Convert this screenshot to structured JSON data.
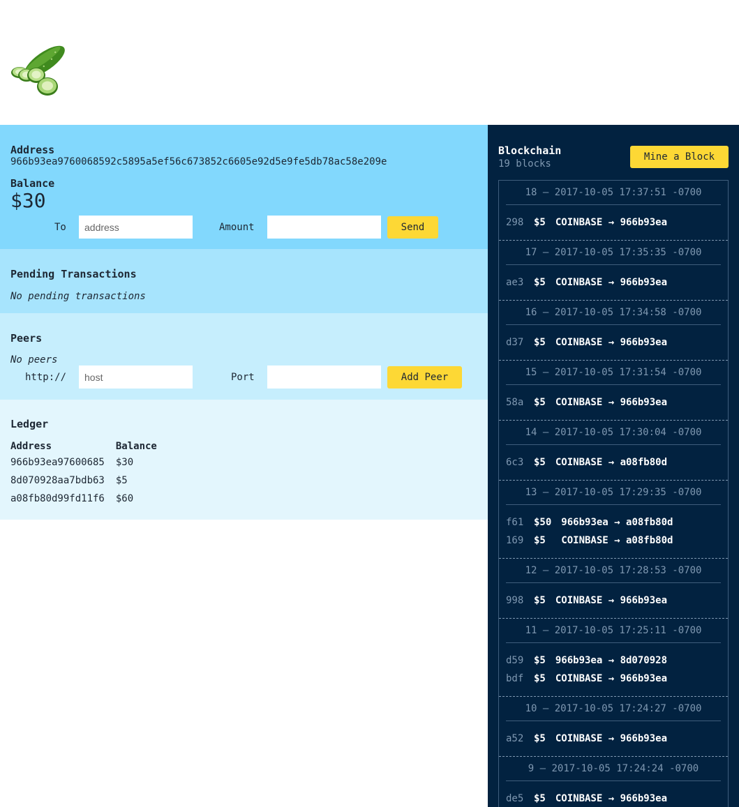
{
  "logo": {
    "icon": "cucumber-icon"
  },
  "wallet": {
    "address_label": "Address",
    "address": "966b93ea9760068592c5895a5ef56c673852c6605e92d5e9fe5db78ac58e209e",
    "balance_label": "Balance",
    "balance": "$30",
    "to_label": "To",
    "to_placeholder": "address",
    "amount_label": "Amount",
    "amount_value": "",
    "send_label": "Send"
  },
  "pending": {
    "title": "Pending Transactions",
    "empty_text": "No pending transactions"
  },
  "peers": {
    "title": "Peers",
    "empty_text": "No peers",
    "protocol_label": "http://",
    "host_placeholder": "host",
    "port_label": "Port",
    "port_value": "",
    "add_label": "Add Peer"
  },
  "ledger": {
    "title": "Ledger",
    "columns": [
      "Address",
      "Balance"
    ],
    "rows": [
      {
        "address": "966b93ea97600685",
        "balance": "$30"
      },
      {
        "address": "8d070928aa7bdb63",
        "balance": "$5"
      },
      {
        "address": "a08fb80d99fd11f6",
        "balance": "$60"
      }
    ]
  },
  "blockchain": {
    "title": "Blockchain",
    "count": "19 blocks",
    "mine_label": "Mine a Block",
    "blocks": [
      {
        "header": "18 — 2017-10-05 17:37:51 -0700",
        "txs": [
          {
            "id": "298",
            "amount": "$5",
            "flow": "COINBASE → 966b93ea"
          }
        ]
      },
      {
        "header": "17 — 2017-10-05 17:35:35 -0700",
        "txs": [
          {
            "id": "ae3",
            "amount": "$5",
            "flow": "COINBASE → 966b93ea"
          }
        ]
      },
      {
        "header": "16 — 2017-10-05 17:34:58 -0700",
        "txs": [
          {
            "id": "d37",
            "amount": "$5",
            "flow": "COINBASE → 966b93ea"
          }
        ]
      },
      {
        "header": "15 — 2017-10-05 17:31:54 -0700",
        "txs": [
          {
            "id": "58a",
            "amount": "$5",
            "flow": "COINBASE → 966b93ea"
          }
        ]
      },
      {
        "header": "14 — 2017-10-05 17:30:04 -0700",
        "txs": [
          {
            "id": "6c3",
            "amount": "$5",
            "flow": "COINBASE → a08fb80d"
          }
        ]
      },
      {
        "header": "13 — 2017-10-05 17:29:35 -0700",
        "txs": [
          {
            "id": "f61",
            "amount": "$50",
            "flow": "966b93ea → a08fb80d"
          },
          {
            "id": "169",
            "amount": "$5",
            "flow": " COINBASE → a08fb80d"
          }
        ]
      },
      {
        "header": "12 — 2017-10-05 17:28:53 -0700",
        "txs": [
          {
            "id": "998",
            "amount": "$5",
            "flow": "COINBASE → 966b93ea"
          }
        ]
      },
      {
        "header": "11 — 2017-10-05 17:25:11 -0700",
        "txs": [
          {
            "id": "d59",
            "amount": "$5",
            "flow": "966b93ea → 8d070928"
          },
          {
            "id": "bdf",
            "amount": "$5",
            "flow": "COINBASE → 966b93ea"
          }
        ]
      },
      {
        "header": "10 — 2017-10-05 17:24:27 -0700",
        "txs": [
          {
            "id": "a52",
            "amount": "$5",
            "flow": "COINBASE → 966b93ea"
          }
        ]
      },
      {
        "header": "9 — 2017-10-05 17:24:24 -0700",
        "txs": [
          {
            "id": "de5",
            "amount": "$5",
            "flow": "COINBASE → 966b93ea"
          }
        ]
      }
    ]
  }
}
